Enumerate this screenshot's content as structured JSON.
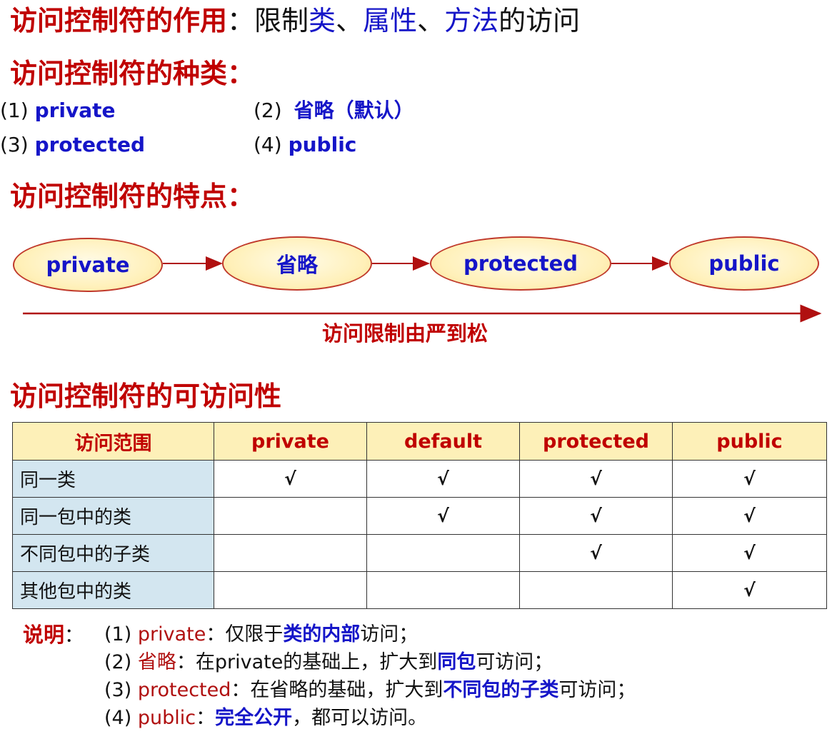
{
  "sections": {
    "purpose": {
      "heading": "访问控制符的作用",
      "colon": "：",
      "text_a": "限制",
      "kw_class": "类",
      "sep1": "、",
      "kw_attr": "属性",
      "sep2": "、",
      "kw_method": "方法",
      "text_b": "的访问"
    },
    "kinds": {
      "heading": "访问控制符的种类：",
      "items": [
        {
          "num": "(1)",
          "label": "private"
        },
        {
          "num": "(2)",
          "label": "省略（默认）"
        },
        {
          "num": "(3)",
          "label": "protected"
        },
        {
          "num": "(4)",
          "label": "public"
        }
      ]
    },
    "features": {
      "heading": "访问控制符的特点：",
      "flow": [
        "private",
        "省略",
        "protected",
        "public"
      ],
      "axis_label": "访问限制由严到松"
    },
    "accessibility": {
      "heading": "访问控制符的可访问性",
      "columns": [
        "访问范围",
        "private",
        "default",
        "protected",
        "public"
      ],
      "rows": [
        {
          "scope": "同一类",
          "marks": [
            "√",
            "√",
            "√",
            "√"
          ]
        },
        {
          "scope": "同一包中的类",
          "marks": [
            "",
            "√",
            "√",
            "√"
          ]
        },
        {
          "scope": "不同包中的子类",
          "marks": [
            "",
            "",
            "√",
            "√"
          ]
        },
        {
          "scope": "其他包中的类",
          "marks": [
            "",
            "",
            "",
            "√"
          ]
        }
      ]
    },
    "notes": {
      "title": "说明",
      "colon": "：",
      "lines": [
        {
          "num": "(1)",
          "kw": "private",
          "sep": "：",
          "text_a": "仅限于",
          "em": "类的内部",
          "text_b": "访问；"
        },
        {
          "num": "(2)",
          "kw": "省略",
          "sep": "：",
          "text_a": "在private的基础上，扩大到",
          "em": "同包",
          "text_b": "可访问；"
        },
        {
          "num": "(3)",
          "kw": "protected",
          "sep": "：",
          "text_a": "在省略的基础，扩大到",
          "em": "不同包的子类",
          "text_b": "可访问；"
        },
        {
          "num": "(4)",
          "kw": "public",
          "sep": "：",
          "text_a": "",
          "em": "完全公开",
          "text_b": "，都可以访问。"
        }
      ]
    }
  },
  "colors": {
    "heading_red": "#c00000",
    "keyword_blue": "#1515c8",
    "ellipse_fill": "#fff0b8",
    "table_header_fill": "#fdf0b8",
    "table_scope_fill": "#d3e6f0"
  },
  "icons": {
    "flow_arrow": "right-arrow",
    "check": "check-mark"
  }
}
